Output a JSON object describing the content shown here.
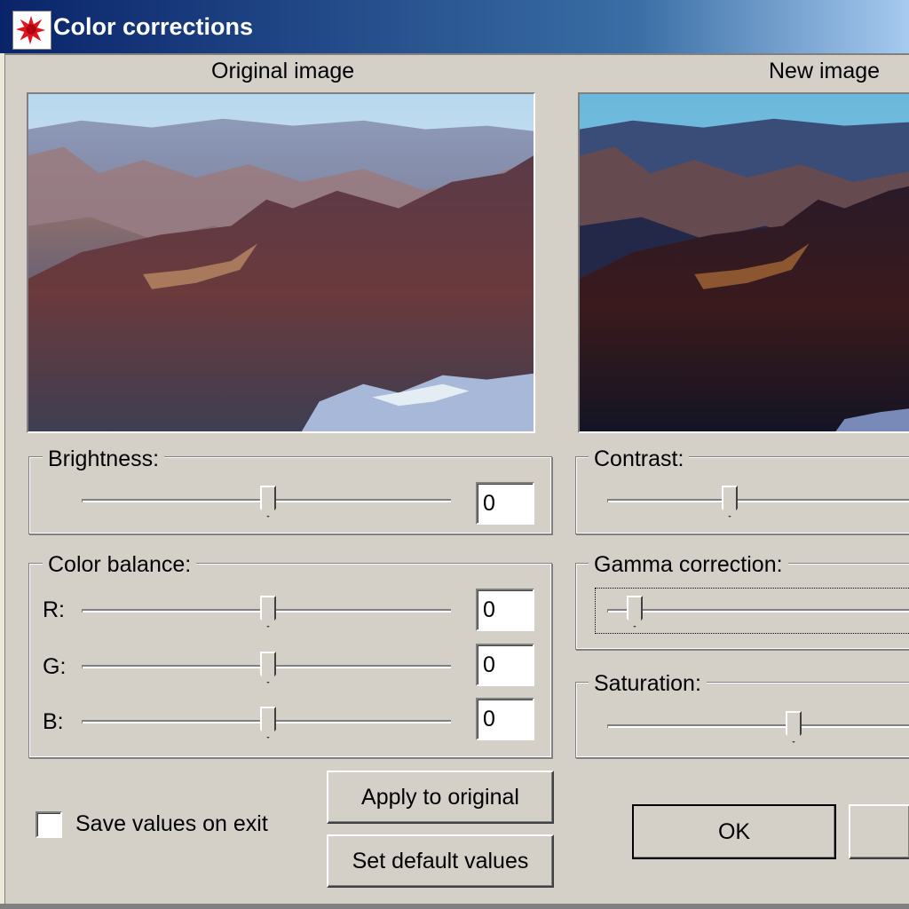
{
  "window": {
    "title": "Color corrections"
  },
  "preview": {
    "original_caption": "Original image",
    "new_caption": "New image"
  },
  "brightness": {
    "label": "Brightness:",
    "value": "0",
    "level": 0
  },
  "color_balance": {
    "label": "Color balance:",
    "r": {
      "label": "R:",
      "value": "0"
    },
    "g": {
      "label": "G:",
      "value": "0"
    },
    "b": {
      "label": "B:",
      "value": "0"
    }
  },
  "contrast": {
    "label": "Contrast:"
  },
  "gamma": {
    "label": "Gamma correction:"
  },
  "saturation": {
    "label": "Saturation:"
  },
  "options": {
    "save_values_label": "Save values on exit",
    "save_values_checked": false
  },
  "buttons": {
    "apply_original": "Apply to original",
    "set_defaults": "Set default values",
    "ok": "OK"
  },
  "colors": {
    "titlebar_start": "#0a246a",
    "titlebar_end": "#a6caf0",
    "dialog_face": "#d4d0c8",
    "icon_accent": "#e0141e"
  }
}
